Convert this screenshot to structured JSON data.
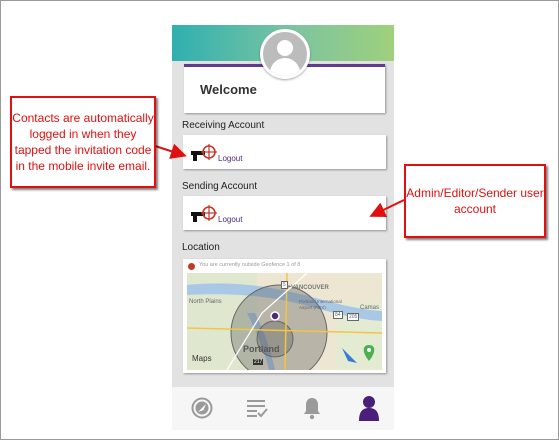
{
  "profile": {
    "welcome_text": "Welcome"
  },
  "receiving_account": {
    "label": "Receiving Account",
    "logout_label": "Logout"
  },
  "sending_account": {
    "label": "Sending Account",
    "logout_label": "Logout"
  },
  "location": {
    "label": "Location",
    "geofence_status": "You are currently outside Geofence 1 of 8",
    "map_labels": {
      "vancouver": "VANCOUVER",
      "north_plains": "North Plains",
      "airport": "Portland International Airport (PDX)",
      "portland": "Portland",
      "camas": "Camas",
      "maps_brand": "Maps",
      "shield_1": "5",
      "shield_2": "84",
      "shield_3": "205",
      "shield_4": "217"
    }
  },
  "tabs": [
    {
      "icon": "compass-icon"
    },
    {
      "icon": "checklist-icon"
    },
    {
      "icon": "bell-icon"
    },
    {
      "icon": "user-icon",
      "active": true
    }
  ],
  "annotations": {
    "contacts_callout": "Contacts are automatically logged in when they tapped the invitation code in the mobile invite email.",
    "admin_callout": "Admin/Editor/Sender user account"
  },
  "colors": {
    "accent": "#5e3b8c",
    "callout_red": "#e01010",
    "geofence_dot": "#c0392b"
  }
}
